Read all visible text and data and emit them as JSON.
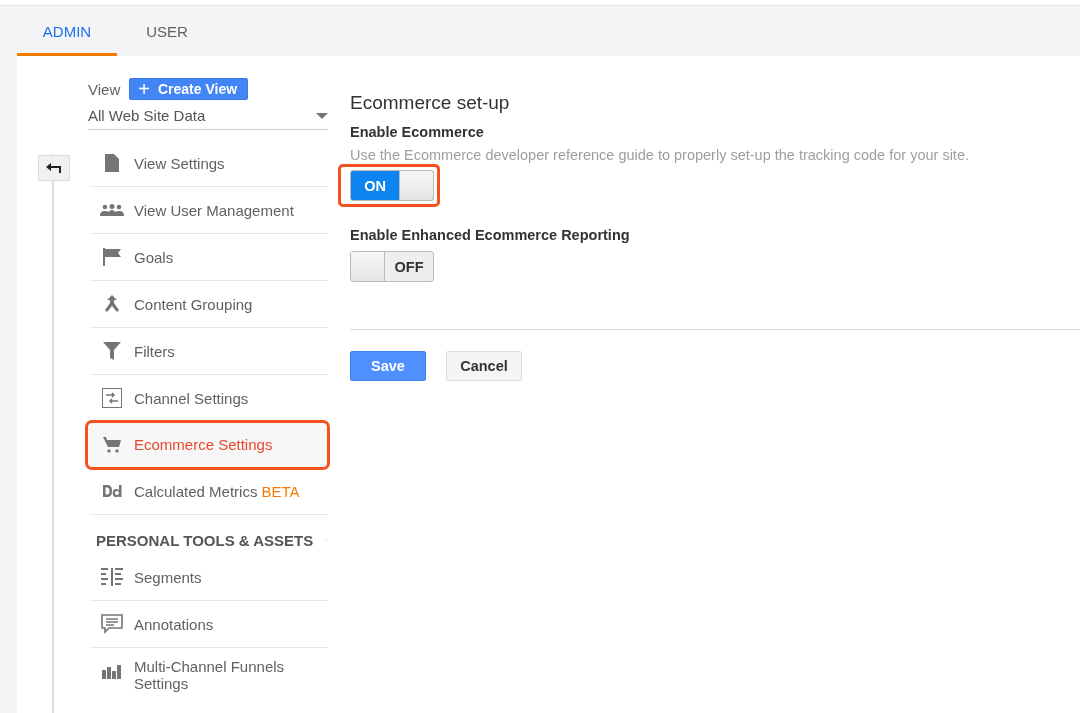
{
  "tabs": [
    {
      "label": "ADMIN",
      "selected": true
    },
    {
      "label": "USER",
      "selected": false
    }
  ],
  "view_selector": {
    "label": "View",
    "create_button": "Create View",
    "plus": "+",
    "dropdown_value": "All Web Site Data"
  },
  "nav": [
    {
      "kind": "item",
      "label": "View Settings",
      "selected": false
    },
    {
      "kind": "item",
      "label": "View User Management",
      "selected": false
    },
    {
      "kind": "item",
      "label": "Goals",
      "selected": false
    },
    {
      "kind": "item",
      "label": "Content Grouping",
      "selected": false
    },
    {
      "kind": "item",
      "label": "Filters",
      "selected": false
    },
    {
      "kind": "item",
      "label": "Channel Settings",
      "selected": false
    },
    {
      "kind": "item",
      "label": "Ecommerce Settings",
      "selected": true
    },
    {
      "kind": "item",
      "label": "Calculated Metrics",
      "badge": "BETA",
      "selected": false
    },
    {
      "kind": "heading",
      "label": "PERSONAL TOOLS & ASSETS"
    },
    {
      "kind": "item",
      "label": "Segments",
      "selected": false
    },
    {
      "kind": "item",
      "label": "Annotations",
      "selected": false
    },
    {
      "kind": "item",
      "label": "Multi-Channel Funnels Settings",
      "selected": false
    }
  ],
  "main": {
    "title": "Ecommerce set-up",
    "settings": [
      {
        "label": "Enable Ecommerce",
        "description": "Use the Ecommerce developer reference guide to properly set-up the tracking code for your site.",
        "toggle": {
          "on": true,
          "text": "ON",
          "highlighted": true
        }
      },
      {
        "label": "Enable Enhanced Ecommerce Reporting",
        "toggle": {
          "on": false,
          "text": "OFF",
          "highlighted": false
        }
      }
    ],
    "buttons": [
      {
        "label": "Save",
        "kind": "primary"
      },
      {
        "label": "Cancel",
        "kind": "secondary"
      }
    ]
  }
}
